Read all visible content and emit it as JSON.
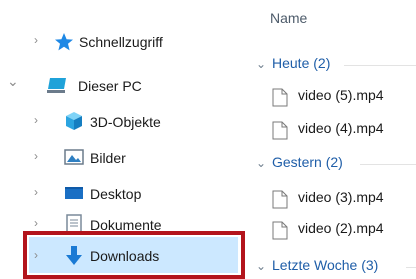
{
  "navigation": {
    "items": [
      {
        "label": "Schnellzugriff",
        "icon": "star-icon",
        "chevron": "›"
      },
      {
        "label": "Dieser PC",
        "icon": "computer-icon",
        "chevron": "⌄"
      },
      {
        "label": "3D-Objekte",
        "icon": "cube-icon",
        "chevron": "›"
      },
      {
        "label": "Bilder",
        "icon": "pictures-icon",
        "chevron": "›"
      },
      {
        "label": "Desktop",
        "icon": "desktop-icon",
        "chevron": "›"
      },
      {
        "label": "Dokumente",
        "icon": "documents-icon",
        "chevron": "›"
      },
      {
        "label": "Downloads",
        "icon": "download-arrow-icon",
        "chevron": "›"
      }
    ]
  },
  "content": {
    "column_header": "Name",
    "groups": [
      {
        "label": "Heute (2)",
        "files": [
          "video (5).mp4",
          "video (4).mp4"
        ]
      },
      {
        "label": "Gestern (2)",
        "files": [
          "video (3).mp4",
          "video (2).mp4"
        ]
      },
      {
        "label": "Letzte Woche (3)",
        "files": []
      }
    ]
  },
  "colors": {
    "selection": "#cce8ff",
    "highlight_border": "#b3141c",
    "group_header_text": "#1f5ea8"
  }
}
